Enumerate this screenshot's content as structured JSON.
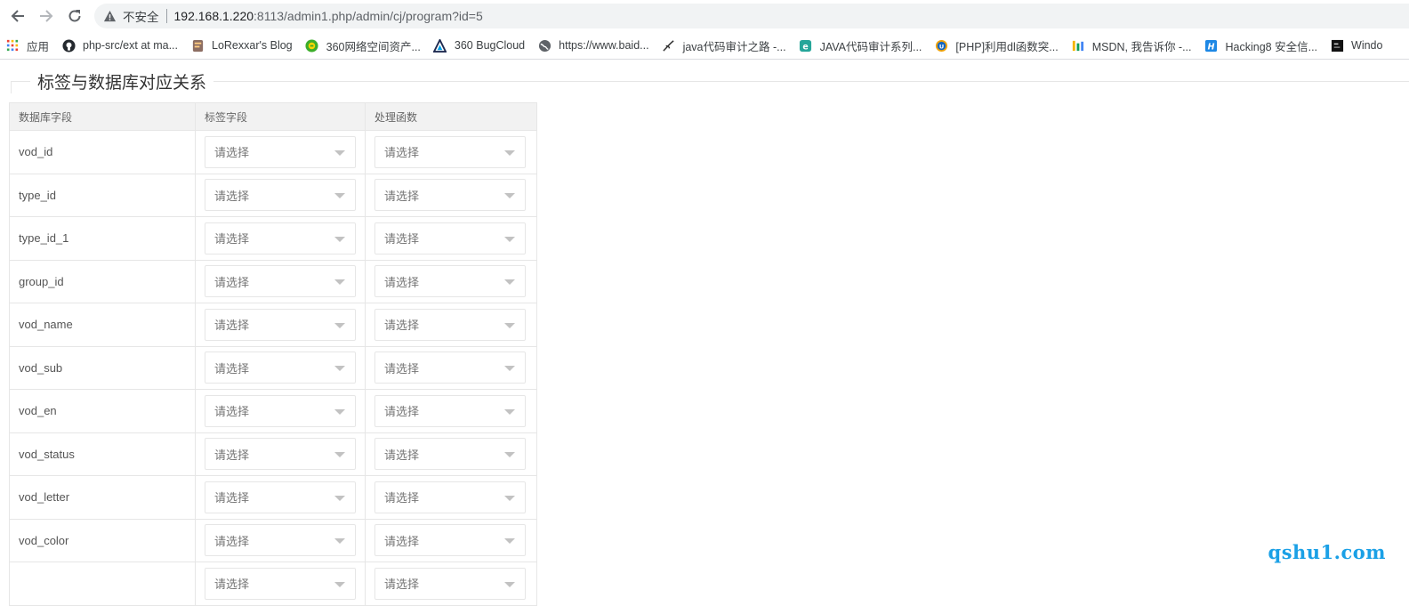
{
  "browser": {
    "security_label": "不安全",
    "url_host": "192.168.1.220",
    "url_rest": ":8113/admin1.php/admin/cj/program?id=5"
  },
  "bookmarks": [
    {
      "label": "应用",
      "icon": "apps-grid-icon"
    },
    {
      "label": "php-src/ext at ma...",
      "icon": "github-icon"
    },
    {
      "label": "LoRexxar's Blog",
      "icon": "blog-icon"
    },
    {
      "label": "360网络空间资产...",
      "icon": "360-icon"
    },
    {
      "label": "360 BugCloud",
      "icon": "bugcloud-icon"
    },
    {
      "label": "https://www.baid...",
      "icon": "globe-icon"
    },
    {
      "label": "java代码审计之路 -...",
      "icon": "feather-icon"
    },
    {
      "label": "JAVA代码审计系列...",
      "icon": "e-icon"
    },
    {
      "label": "[PHP]利用dl函数突...",
      "icon": "circle-u-icon"
    },
    {
      "label": "MSDN, 我告诉你 -...",
      "icon": "msdn-icon"
    },
    {
      "label": "Hacking8 安全信...",
      "icon": "h-icon"
    },
    {
      "label": "Windo",
      "icon": "terminal-icon"
    }
  ],
  "page": {
    "section_title": "标签与数据库对应关系"
  },
  "table": {
    "headers": [
      "数据库字段",
      "标签字段",
      "处理函数"
    ],
    "select_placeholder": "请选择",
    "rows": [
      {
        "field": "vod_id"
      },
      {
        "field": "type_id"
      },
      {
        "field": "type_id_1"
      },
      {
        "field": "group_id"
      },
      {
        "field": "vod_name"
      },
      {
        "field": "vod_sub"
      },
      {
        "field": "vod_en"
      },
      {
        "field": "vod_status"
      },
      {
        "field": "vod_letter"
      },
      {
        "field": "vod_color"
      },
      {
        "field": ""
      }
    ]
  },
  "watermark": "qshu1.com"
}
